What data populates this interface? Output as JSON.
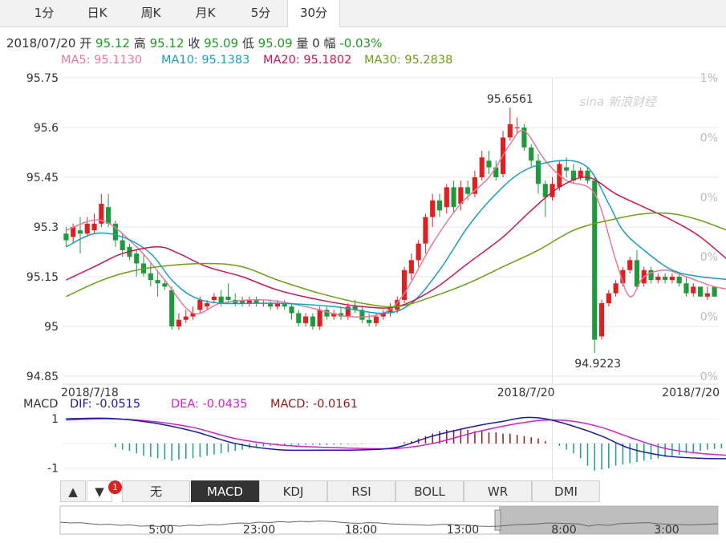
{
  "tabs": [
    {
      "label": "1分"
    },
    {
      "label": "日K"
    },
    {
      "label": "周K"
    },
    {
      "label": "月K"
    },
    {
      "label": "5分"
    },
    {
      "label": "30分",
      "active": true
    }
  ],
  "info": {
    "date": "2018/07/20",
    "open_label": "开",
    "open": "95.12",
    "high_label": "高",
    "high": "95.12",
    "close_label": "收",
    "close": "95.09",
    "low_label": "低",
    "low": "95.09",
    "vol_label": "量",
    "vol": "0",
    "amp_label": "幅",
    "amp": "-0.03%"
  },
  "ma": [
    {
      "text": "MA5: 95.1130",
      "color": "#e8799a"
    },
    {
      "text": "MA10: 95.1383",
      "color": "#1a9fbc"
    },
    {
      "text": "MA20: 95.1802",
      "color": "#c8164f"
    },
    {
      "text": "MA30: 95.2838",
      "color": "#6e9e14"
    }
  ],
  "watermark": "新浪财经",
  "colors": {
    "up": "#e02020",
    "down": "#1e9a3c",
    "grid": "#e6e6e6"
  },
  "chart_data": {
    "type": "candlestick",
    "y_ticks": [
      "95.75",
      "95.6",
      "95.45",
      "95.3",
      "95.15",
      "95",
      "94.85"
    ],
    "ylim": [
      94.85,
      95.75
    ],
    "right_ticks": [
      "1%",
      "0%",
      "0%",
      "0%",
      "0%",
      "0%"
    ],
    "x_labels": [
      {
        "text": "2018/7/18",
        "i": 0
      },
      {
        "text": "2018/7/20",
        "i": 69
      },
      {
        "text": "2018/7/20",
        "i": 95
      }
    ],
    "max_label": "95.6561",
    "min_label": "94.9223",
    "candles": [
      [
        95.28,
        95.26,
        95.3,
        95.24
      ],
      [
        95.27,
        95.3,
        95.31,
        95.25
      ],
      [
        95.29,
        95.28,
        95.33,
        95.22
      ],
      [
        95.28,
        95.31,
        95.33,
        95.27
      ],
      [
        95.29,
        95.31,
        95.34,
        95.28
      ],
      [
        95.31,
        95.37,
        95.4,
        95.3
      ],
      [
        95.36,
        95.31,
        95.4,
        95.3
      ],
      [
        95.31,
        95.26,
        95.32,
        95.24
      ],
      [
        95.26,
        95.23,
        95.28,
        95.21
      ],
      [
        95.24,
        95.21,
        95.25,
        95.2
      ],
      [
        95.22,
        95.19,
        95.23,
        95.15
      ],
      [
        95.19,
        95.16,
        95.22,
        95.15
      ],
      [
        95.16,
        95.14,
        95.19,
        95.12
      ],
      [
        95.14,
        95.13,
        95.17,
        95.09
      ],
      [
        95.13,
        95.12,
        95.14,
        95.11
      ],
      [
        95.11,
        95.0,
        95.12,
        94.99
      ],
      [
        95.0,
        95.02,
        95.04,
        94.99
      ],
      [
        95.02,
        95.03,
        95.05,
        95.01
      ],
      [
        95.03,
        95.04,
        95.06,
        95.02
      ],
      [
        95.05,
        95.08,
        95.09,
        95.04
      ],
      [
        95.06,
        95.07,
        95.08,
        95.05
      ],
      [
        95.08,
        95.09,
        95.1,
        95.07
      ],
      [
        95.09,
        95.07,
        95.11,
        95.06
      ],
      [
        95.09,
        95.08,
        95.13,
        95.07
      ],
      [
        95.08,
        95.07,
        95.1,
        95.06
      ],
      [
        95.08,
        95.07,
        95.09,
        95.06
      ],
      [
        95.07,
        95.08,
        95.09,
        95.06
      ],
      [
        95.08,
        95.07,
        95.09,
        95.06
      ],
      [
        95.07,
        95.07,
        95.08,
        95.06
      ],
      [
        95.07,
        95.06,
        95.08,
        95.05
      ],
      [
        95.06,
        95.07,
        95.08,
        95.05
      ],
      [
        95.07,
        95.06,
        95.08,
        95.05
      ],
      [
        95.06,
        95.04,
        95.07,
        95.02
      ],
      [
        95.04,
        95.01,
        95.05,
        95.0
      ],
      [
        95.01,
        95.03,
        95.04,
        95.0
      ],
      [
        95.03,
        95.0,
        95.04,
        94.99
      ],
      [
        95.0,
        95.05,
        95.06,
        94.99
      ],
      [
        95.05,
        95.03,
        95.06,
        95.02
      ],
      [
        95.03,
        95.04,
        95.05,
        95.02
      ],
      [
        95.04,
        95.03,
        95.06,
        95.02
      ],
      [
        95.03,
        95.06,
        95.07,
        95.02
      ],
      [
        95.06,
        95.05,
        95.08,
        95.04
      ],
      [
        95.05,
        95.02,
        95.06,
        95.01
      ],
      [
        95.02,
        95.01,
        95.04,
        95.0
      ],
      [
        95.01,
        95.03,
        95.04,
        95.0
      ],
      [
        95.03,
        95.04,
        95.05,
        95.02
      ],
      [
        95.04,
        95.06,
        95.07,
        95.03
      ],
      [
        95.05,
        95.08,
        95.09,
        95.04
      ],
      [
        95.08,
        95.17,
        95.18,
        95.07
      ],
      [
        95.16,
        95.2,
        95.22,
        95.14
      ],
      [
        95.2,
        95.25,
        95.26,
        95.18
      ],
      [
        95.25,
        95.33,
        95.34,
        95.22
      ],
      [
        95.33,
        95.38,
        95.4,
        95.3
      ],
      [
        95.38,
        95.35,
        95.4,
        95.33
      ],
      [
        95.36,
        95.42,
        95.43,
        95.34
      ],
      [
        95.42,
        95.36,
        95.44,
        95.34
      ],
      [
        95.37,
        95.42,
        95.44,
        95.35
      ],
      [
        95.42,
        95.4,
        95.44,
        95.38
      ],
      [
        95.4,
        95.45,
        95.47,
        95.39
      ],
      [
        95.45,
        95.51,
        95.53,
        95.44
      ],
      [
        95.5,
        95.48,
        95.53,
        95.46
      ],
      [
        95.48,
        95.45,
        95.5,
        95.44
      ],
      [
        95.46,
        95.57,
        95.59,
        95.45
      ],
      [
        95.57,
        95.61,
        95.66,
        95.56
      ],
      [
        95.6,
        95.6,
        95.63,
        95.58
      ],
      [
        95.6,
        95.54,
        95.61,
        95.53
      ],
      [
        95.54,
        95.5,
        95.55,
        95.48
      ],
      [
        95.5,
        95.43,
        95.52,
        95.4
      ],
      [
        95.43,
        95.39,
        95.44,
        95.33
      ],
      [
        95.39,
        95.43,
        95.45,
        95.38
      ],
      [
        95.42,
        95.49,
        95.5,
        95.41
      ],
      [
        95.48,
        95.47,
        95.51,
        95.45
      ],
      [
        95.47,
        95.44,
        95.49,
        95.43
      ],
      [
        95.45,
        95.47,
        95.48,
        95.44
      ],
      [
        95.47,
        95.44,
        95.48,
        95.43
      ],
      [
        95.44,
        94.96,
        95.45,
        94.92
      ],
      [
        94.97,
        95.07,
        95.08,
        94.96
      ],
      [
        95.07,
        95.1,
        95.11,
        95.06
      ],
      [
        95.1,
        95.13,
        95.14,
        95.09
      ],
      [
        95.13,
        95.17,
        95.18,
        95.12
      ],
      [
        95.17,
        95.2,
        95.21,
        95.16
      ],
      [
        95.2,
        95.12,
        95.23,
        95.11
      ],
      [
        95.13,
        95.17,
        95.18,
        95.12
      ],
      [
        95.17,
        95.14,
        95.18,
        95.13
      ],
      [
        95.14,
        95.15,
        95.16,
        95.13
      ],
      [
        95.15,
        95.14,
        95.16,
        95.13
      ],
      [
        95.14,
        95.15,
        95.16,
        95.13
      ],
      [
        95.15,
        95.13,
        95.16,
        95.12
      ],
      [
        95.13,
        95.1,
        95.15,
        95.09
      ],
      [
        95.1,
        95.12,
        95.13,
        95.09
      ],
      [
        95.12,
        95.09,
        95.12,
        95.09
      ],
      [
        95.09,
        95.1,
        95.12,
        95.08
      ],
      [
        95.12,
        95.09,
        95.12,
        95.09
      ]
    ],
    "ma_lines": [
      {
        "name": "MA5",
        "color": "#e8799a",
        "pts": [
          [
            0,
            95.29
          ],
          [
            5,
            95.32
          ],
          [
            10,
            95.24
          ],
          [
            14,
            95.14
          ],
          [
            18,
            95.04
          ],
          [
            22,
            95.07
          ],
          [
            28,
            95.08
          ],
          [
            34,
            95.06
          ],
          [
            40,
            95.03
          ],
          [
            45,
            95.04
          ],
          [
            48,
            95.1
          ],
          [
            52,
            95.25
          ],
          [
            56,
            95.37
          ],
          [
            60,
            95.45
          ],
          [
            63,
            95.55
          ],
          [
            65,
            95.59
          ],
          [
            68,
            95.5
          ],
          [
            71,
            95.44
          ],
          [
            75,
            95.4
          ],
          [
            78,
            95.2
          ],
          [
            80,
            95.09
          ],
          [
            82,
            95.15
          ],
          [
            85,
            95.17
          ],
          [
            88,
            95.15
          ],
          [
            92,
            95.12
          ],
          [
            95,
            95.11
          ]
        ]
      },
      {
        "name": "MA10",
        "color": "#1a9fbc",
        "pts": [
          [
            0,
            95.24
          ],
          [
            4,
            95.28
          ],
          [
            8,
            95.27
          ],
          [
            12,
            95.22
          ],
          [
            15,
            95.14
          ],
          [
            18,
            95.09
          ],
          [
            22,
            95.07
          ],
          [
            30,
            95.07
          ],
          [
            38,
            95.06
          ],
          [
            45,
            95.04
          ],
          [
            49,
            95.07
          ],
          [
            53,
            95.17
          ],
          [
            57,
            95.3
          ],
          [
            61,
            95.4
          ],
          [
            65,
            95.47
          ],
          [
            70,
            95.5
          ],
          [
            74,
            95.48
          ],
          [
            77,
            95.37
          ],
          [
            79,
            95.29
          ],
          [
            82,
            95.23
          ],
          [
            86,
            95.17
          ],
          [
            90,
            95.15
          ],
          [
            95,
            95.14
          ]
        ]
      },
      {
        "name": "MA20",
        "color": "#c8164f",
        "pts": [
          [
            0,
            95.14
          ],
          [
            4,
            95.18
          ],
          [
            8,
            95.22
          ],
          [
            13,
            95.24
          ],
          [
            16,
            95.22
          ],
          [
            20,
            95.18
          ],
          [
            25,
            95.15
          ],
          [
            30,
            95.11
          ],
          [
            36,
            95.08
          ],
          [
            42,
            95.06
          ],
          [
            47,
            95.06
          ],
          [
            52,
            95.11
          ],
          [
            57,
            95.19
          ],
          [
            62,
            95.27
          ],
          [
            66,
            95.35
          ],
          [
            70,
            95.42
          ],
          [
            74,
            95.45
          ],
          [
            78,
            95.4
          ],
          [
            82,
            95.36
          ],
          [
            86,
            95.32
          ],
          [
            90,
            95.27
          ],
          [
            95,
            95.18
          ]
        ]
      },
      {
        "name": "MA30",
        "color": "#6e9e14",
        "pts": [
          [
            0,
            95.09
          ],
          [
            4,
            95.13
          ],
          [
            8,
            95.16
          ],
          [
            13,
            95.18
          ],
          [
            20,
            95.19
          ],
          [
            25,
            95.18
          ],
          [
            30,
            95.14
          ],
          [
            36,
            95.1
          ],
          [
            42,
            95.07
          ],
          [
            47,
            95.06
          ],
          [
            52,
            95.09
          ],
          [
            57,
            95.13
          ],
          [
            62,
            95.18
          ],
          [
            67,
            95.23
          ],
          [
            72,
            95.29
          ],
          [
            77,
            95.32
          ],
          [
            82,
            95.34
          ],
          [
            86,
            95.34
          ],
          [
            90,
            95.32
          ],
          [
            95,
            95.28
          ]
        ]
      }
    ],
    "macd": {
      "header": {
        "title": "MACD",
        "dif": "DIF: -0.0515",
        "dea": "DEA: -0.0435",
        "macd": "MACD: -0.0161"
      },
      "colors": {
        "dif": "#1a1a9f",
        "dea": "#cc22cc",
        "pos": "#8b1a1a",
        "neg": "#1a9f8a"
      },
      "y_ticks": [
        "1",
        "-1"
      ],
      "ylim": [
        -1.4,
        1.2
      ],
      "dif": [
        [
          0,
          1.0
        ],
        [
          6,
          1.02
        ],
        [
          12,
          0.85
        ],
        [
          18,
          0.5
        ],
        [
          24,
          0.0
        ],
        [
          30,
          -0.25
        ],
        [
          36,
          -0.27
        ],
        [
          42,
          -0.26
        ],
        [
          47,
          -0.15
        ],
        [
          52,
          0.3
        ],
        [
          58,
          0.7
        ],
        [
          62,
          0.9
        ],
        [
          65,
          1.05
        ],
        [
          68,
          1.0
        ],
        [
          72,
          0.7
        ],
        [
          76,
          0.3
        ],
        [
          80,
          -0.2
        ],
        [
          85,
          -0.5
        ],
        [
          90,
          -0.6
        ],
        [
          95,
          -0.62
        ]
      ],
      "dea": [
        [
          0,
          0.95
        ],
        [
          6,
          1.0
        ],
        [
          12,
          0.9
        ],
        [
          18,
          0.65
        ],
        [
          24,
          0.2
        ],
        [
          30,
          -0.05
        ],
        [
          36,
          -0.15
        ],
        [
          42,
          -0.2
        ],
        [
          47,
          -0.2
        ],
        [
          52,
          0.0
        ],
        [
          58,
          0.45
        ],
        [
          62,
          0.7
        ],
        [
          65,
          0.85
        ],
        [
          68,
          0.95
        ],
        [
          72,
          0.9
        ],
        [
          76,
          0.65
        ],
        [
          80,
          0.25
        ],
        [
          85,
          -0.2
        ],
        [
          90,
          -0.4
        ],
        [
          95,
          -0.5
        ]
      ],
      "hist": [
        0,
        0,
        0,
        0,
        0,
        0,
        0,
        -0.15,
        -0.25,
        -0.3,
        -0.4,
        -0.5,
        -0.55,
        -0.6,
        -0.65,
        -0.7,
        -0.65,
        -0.62,
        -0.6,
        -0.55,
        -0.5,
        -0.45,
        -0.4,
        -0.35,
        -0.3,
        -0.25,
        -0.2,
        -0.15,
        -0.12,
        -0.1,
        -0.08,
        -0.06,
        -0.06,
        -0.07,
        -0.05,
        -0.05,
        -0.06,
        -0.06,
        -0.05,
        -0.04,
        -0.03,
        -0.02,
        -0.02,
        0,
        0,
        0,
        0,
        0,
        0.05,
        0.1,
        0.2,
        0.3,
        0.4,
        0.5,
        0.55,
        0.55,
        0.55,
        0.55,
        0.5,
        0.5,
        0.45,
        0.45,
        0.4,
        0.4,
        0.35,
        0.3,
        0.25,
        0.2,
        0.1,
        0,
        -0.1,
        -0.25,
        -0.4,
        -0.6,
        -0.9,
        -1.1,
        -1.05,
        -1.0,
        -0.9,
        -0.85,
        -0.8,
        -0.75,
        -0.7,
        -0.65,
        -0.6,
        -0.55,
        -0.5,
        -0.45,
        -0.4,
        -0.35,
        -0.3,
        -0.25,
        -0.22,
        -0.2,
        -0.2,
        -0.18
      ]
    }
  },
  "toolbar": {
    "up_label": "▲",
    "down_label": "▼",
    "badge": "1",
    "buttons": [
      {
        "label": "无"
      },
      {
        "label": "MACD",
        "active": true
      },
      {
        "label": "KDJ"
      },
      {
        "label": "RSI"
      },
      {
        "label": "BOLL"
      },
      {
        "label": "WR"
      },
      {
        "label": "DMI"
      }
    ]
  },
  "navigator": {
    "labels": [
      "5:00",
      "23:00",
      "18:00",
      "13:00",
      "8:00",
      "3:00"
    ],
    "series": [
      0.55,
      0.5,
      0.52,
      0.45,
      0.4,
      0.42,
      0.35,
      0.38,
      0.3,
      0.32,
      0.28,
      0.35,
      0.3,
      0.36,
      0.33,
      0.4,
      0.38,
      0.45,
      0.5,
      0.48,
      0.55,
      0.52,
      0.58,
      0.55,
      0.6,
      0.58,
      0.62,
      0.6,
      0.55,
      0.5,
      0.48,
      0.52,
      0.5,
      0.45,
      0.42,
      0.4,
      0.38,
      0.35,
      0.4,
      0.42,
      0.38,
      0.36,
      0.3,
      0.28,
      0.3,
      0.35,
      0.4,
      0.42,
      0.45,
      0.5,
      0.48,
      0.46,
      0.44,
      0.3,
      0.4,
      0.35,
      0.45,
      0.48,
      0.5,
      0.52,
      0.45,
      0.42,
      0.4,
      0.38,
      0.4,
      0.42,
      0.45
    ]
  },
  "scroll_arrows": {
    "left": "▲",
    "right": "▼"
  }
}
